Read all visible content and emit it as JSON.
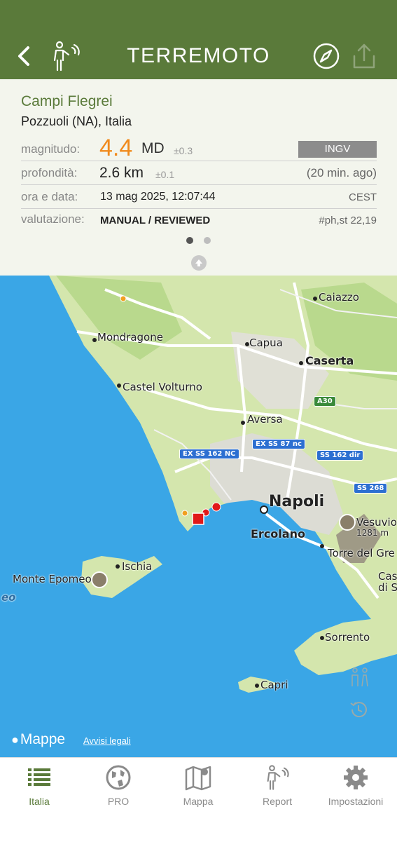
{
  "header": {
    "title": "TERREMOTO"
  },
  "event": {
    "name": "Campi Flegrei",
    "location": "Pozzuoli (NA), Italia",
    "magnitude_label": "magnitudo:",
    "magnitude": "4.4",
    "magnitude_type": "MD",
    "magnitude_error": "±0.3",
    "agency": "INGV",
    "depth_label": "profondità:",
    "depth": "2.6 km",
    "depth_error": "±0.1",
    "time_ago": "(20 min. ago)",
    "datetime_label": "ora e data:",
    "datetime": "13 mag 2025, 12:07:44",
    "timezone": "CEST",
    "evaluation_label": "valutazione:",
    "evaluation": "MANUAL / REVIEWED",
    "stations": "#ph,st 22,19"
  },
  "pager": {
    "count": 2,
    "active": 0
  },
  "map": {
    "places": [
      "Caiazzo",
      "Mondragone",
      "Capua",
      "Caserta",
      "Castel Volturno",
      "Aversa",
      "Napoli",
      "Ercolano",
      "Torre del Gre",
      "Vesuvio",
      "1281 m",
      "Ischia",
      "Monte Epomeo",
      "Sorrento",
      "Capri",
      "Cas",
      "di S",
      "eo"
    ],
    "roads": [
      "A30",
      "EX SS 162 NC",
      "EX SS 87 nc",
      "SS 162 dir",
      "SS 268"
    ],
    "attribution": "Mappe",
    "legal": "Avvisi legali"
  },
  "tabs": [
    {
      "label": "Italia",
      "icon": "list-icon"
    },
    {
      "label": "PRO",
      "icon": "globe-icon"
    },
    {
      "label": "Mappa",
      "icon": "map-icon"
    },
    {
      "label": "Report",
      "icon": "person-report-icon"
    },
    {
      "label": "Impostazioni",
      "icon": "gear-icon"
    }
  ],
  "colors": {
    "header": "#5a7a3a",
    "accent": "#f08a1c",
    "epicenter": "#e11919",
    "sea": "#3aa6e6",
    "land": "#cfe3a8"
  }
}
